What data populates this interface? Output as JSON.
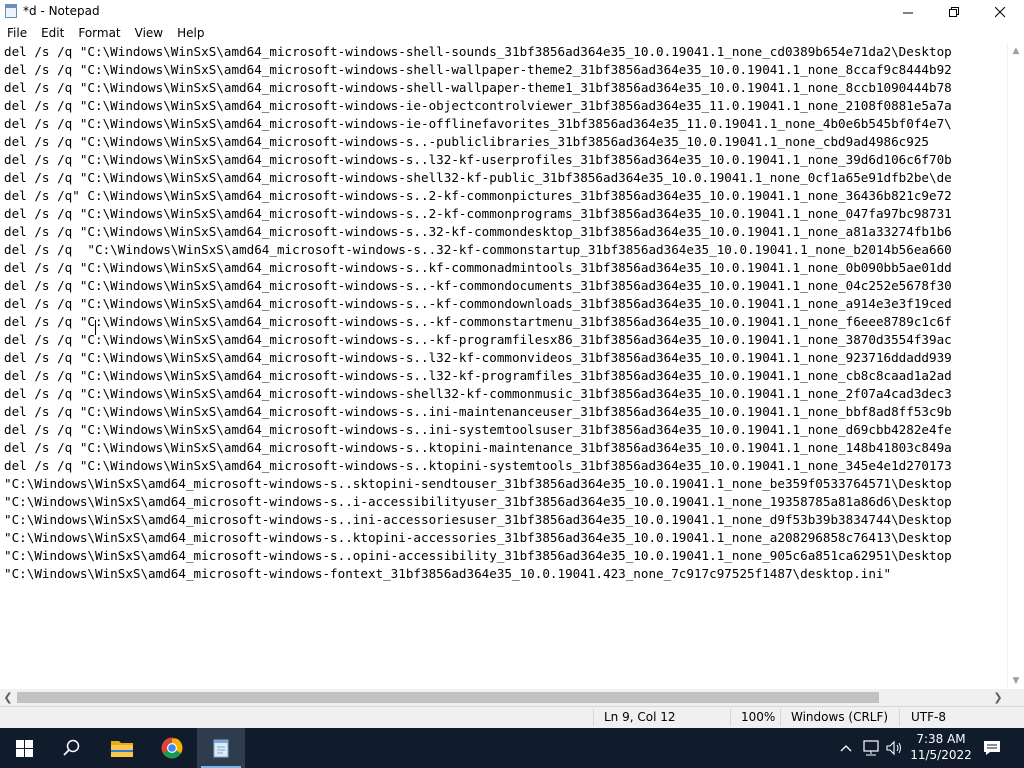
{
  "window": {
    "title": "*d - Notepad"
  },
  "menu": [
    "File",
    "Edit",
    "Format",
    "View",
    "Help"
  ],
  "editor": {
    "lines": [
      "del /s /q \"C:\\Windows\\WinSxS\\amd64_microsoft-windows-shell-sounds_31bf3856ad364e35_10.0.19041.1_none_cd0389b654e71da2\\Desktop",
      "del /s /q \"C:\\Windows\\WinSxS\\amd64_microsoft-windows-shell-wallpaper-theme2_31bf3856ad364e35_10.0.19041.1_none_8ccaf9c8444b92",
      "del /s /q \"C:\\Windows\\WinSxS\\amd64_microsoft-windows-shell-wallpaper-theme1_31bf3856ad364e35_10.0.19041.1_none_8ccb1090444b78",
      "del /s /q \"C:\\Windows\\WinSxS\\amd64_microsoft-windows-ie-objectcontrolviewer_31bf3856ad364e35_11.0.19041.1_none_2108f0881e5a7a",
      "del /s /q \"C:\\Windows\\WinSxS\\amd64_microsoft-windows-ie-offlinefavorites_31bf3856ad364e35_11.0.19041.1_none_4b0e6b545bf0f4e7\\",
      "del /s /q \"C:\\Windows\\WinSxS\\amd64_microsoft-windows-s..-publiclibraries_31bf3856ad364e35_10.0.19041.1_none_cbd9ad4986c925",
      "del /s /q \"C:\\Windows\\WinSxS\\amd64_microsoft-windows-s..l32-kf-userprofiles_31bf3856ad364e35_10.0.19041.1_none_39d6d106c6f70b",
      "del /s /q \"C:\\Windows\\WinSxS\\amd64_microsoft-windows-shell32-kf-public_31bf3856ad364e35_10.0.19041.1_none_0cf1a65e91dfb2be\\de",
      "del /s /q\" C:\\Windows\\WinSxS\\amd64_microsoft-windows-s..2-kf-commonpictures_31bf3856ad364e35_10.0.19041.1_none_36436b821c9e72",
      "del /s /q \"C:\\Windows\\WinSxS\\amd64_microsoft-windows-s..2-kf-commonprograms_31bf3856ad364e35_10.0.19041.1_none_047fa97bc98731",
      "del /s /q \"C:\\Windows\\WinSxS\\amd64_microsoft-windows-s..32-kf-commondesktop_31bf3856ad364e35_10.0.19041.1_none_a81a33274fb1b6",
      "del /s /q  \"C:\\Windows\\WinSxS\\amd64_microsoft-windows-s..32-kf-commonstartup_31bf3856ad364e35_10.0.19041.1_none_b2014b56ea660",
      "del /s /q \"C:\\Windows\\WinSxS\\amd64_microsoft-windows-s..kf-commonadmintools_31bf3856ad364e35_10.0.19041.1_none_0b090bb5ae01dd",
      "del /s /q \"C:\\Windows\\WinSxS\\amd64_microsoft-windows-s..-kf-commondocuments_31bf3856ad364e35_10.0.19041.1_none_04c252e5678f30",
      "del /s /q \"C:\\Windows\\WinSxS\\amd64_microsoft-windows-s..-kf-commondownloads_31bf3856ad364e35_10.0.19041.1_none_a914e3e3f19ced",
      "del /s /q \"C:\\Windows\\WinSxS\\amd64_microsoft-windows-s..-kf-commonstartmenu_31bf3856ad364e35_10.0.19041.1_none_f6eee8789c1c6f",
      "del /s /q \"C:\\Windows\\WinSxS\\amd64_microsoft-windows-s..-kf-programfilesx86_31bf3856ad364e35_10.0.19041.1_none_3870d3554f39ac",
      "del /s /q \"C:\\Windows\\WinSxS\\amd64_microsoft-windows-s..l32-kf-commonvideos_31bf3856ad364e35_10.0.19041.1_none_923716ddadd939",
      "del /s /q \"C:\\Windows\\WinSxS\\amd64_microsoft-windows-s..l32-kf-programfiles_31bf3856ad364e35_10.0.19041.1_none_cb8c8caad1a2ad",
      "del /s /q \"C:\\Windows\\WinSxS\\amd64_microsoft-windows-shell32-kf-commonmusic_31bf3856ad364e35_10.0.19041.1_none_2f07a4cad3dec3",
      "del /s /q \"C:\\Windows\\WinSxS\\amd64_microsoft-windows-s..ini-maintenanceuser_31bf3856ad364e35_10.0.19041.1_none_bbf8ad8ff53c9b",
      "del /s /q \"C:\\Windows\\WinSxS\\amd64_microsoft-windows-s..ini-systemtoolsuser_31bf3856ad364e35_10.0.19041.1_none_d69cbb4282e4fe",
      "del /s /q \"C:\\Windows\\WinSxS\\amd64_microsoft-windows-s..ktopini-maintenance_31bf3856ad364e35_10.0.19041.1_none_148b41803c849a",
      "del /s /q \"C:\\Windows\\WinSxS\\amd64_microsoft-windows-s..ktopini-systemtools_31bf3856ad364e35_10.0.19041.1_none_345e4e1d270173",
      "\"C:\\Windows\\WinSxS\\amd64_microsoft-windows-s..sktopini-sendtouser_31bf3856ad364e35_10.0.19041.1_none_be359f0533764571\\Desktop",
      "\"C:\\Windows\\WinSxS\\amd64_microsoft-windows-s..i-accessibilityuser_31bf3856ad364e35_10.0.19041.1_none_19358785a81a86d6\\Desktop",
      "\"C:\\Windows\\WinSxS\\amd64_microsoft-windows-s..ini-accessoriesuser_31bf3856ad364e35_10.0.19041.1_none_d9f53b39b3834744\\Desktop",
      "\"C:\\Windows\\WinSxS\\amd64_microsoft-windows-s..ktopini-accessories_31bf3856ad364e35_10.0.19041.1_none_a208296858c76413\\Desktop",
      "\"C:\\Windows\\WinSxS\\amd64_microsoft-windows-s..opini-accessibility_31bf3856ad364e35_10.0.19041.1_none_905c6a851ca62951\\Desktop",
      "\"C:\\Windows\\WinSxS\\amd64_microsoft-windows-fontext_31bf3856ad364e35_10.0.19041.423_none_7c917c97525f1487\\desktop.ini\""
    ]
  },
  "status": {
    "position": "Ln 9, Col 12",
    "zoom": "100%",
    "line_ending": "Windows (CRLF)",
    "encoding": "UTF-8"
  },
  "taskbar": {
    "time": "7:38 AM",
    "date": "11/5/2022",
    "pinned_icons": [
      "windows-start-icon",
      "search-icon",
      "file-explorer-icon",
      "chrome-icon",
      "notepad-icon"
    ],
    "tray_icons": [
      "chevron-up-icon",
      "network-icon",
      "volume-icon",
      "notification-icon"
    ]
  },
  "colors": {
    "taskbar": "#101c2c",
    "accent": "#76b9ed",
    "status_bar": "#f0f0f0"
  }
}
